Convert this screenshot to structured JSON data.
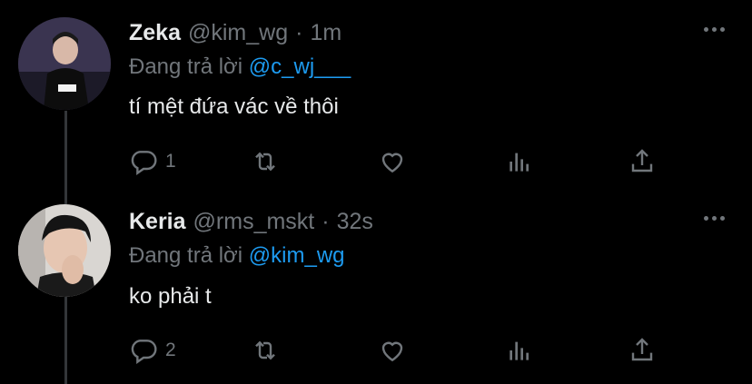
{
  "colors": {
    "background": "#000000",
    "text_primary": "#e7e9ea",
    "text_secondary": "#71767b",
    "accent": "#1d9bf0",
    "thread_line": "#333639"
  },
  "tweets": [
    {
      "name": "Zeka",
      "handle": "@kim_wg",
      "separator": "·",
      "time": "1m",
      "reply_prefix": "Đang trả lời",
      "reply_to": "@c_wj___",
      "text": "tí mệt đứa vác về thôi",
      "reply_count": "1",
      "icons": [
        "reply-icon",
        "retweet-icon",
        "like-icon",
        "stats-icon",
        "share-icon",
        "more-icon"
      ]
    },
    {
      "name": "Keria",
      "handle": "@rms_mskt",
      "separator": "·",
      "time": "32s",
      "reply_prefix": "Đang trả lời",
      "reply_to": "@kim_wg",
      "text": "ko phải t",
      "reply_count": "2",
      "icons": [
        "reply-icon",
        "retweet-icon",
        "like-icon",
        "stats-icon",
        "share-icon",
        "more-icon"
      ]
    }
  ]
}
